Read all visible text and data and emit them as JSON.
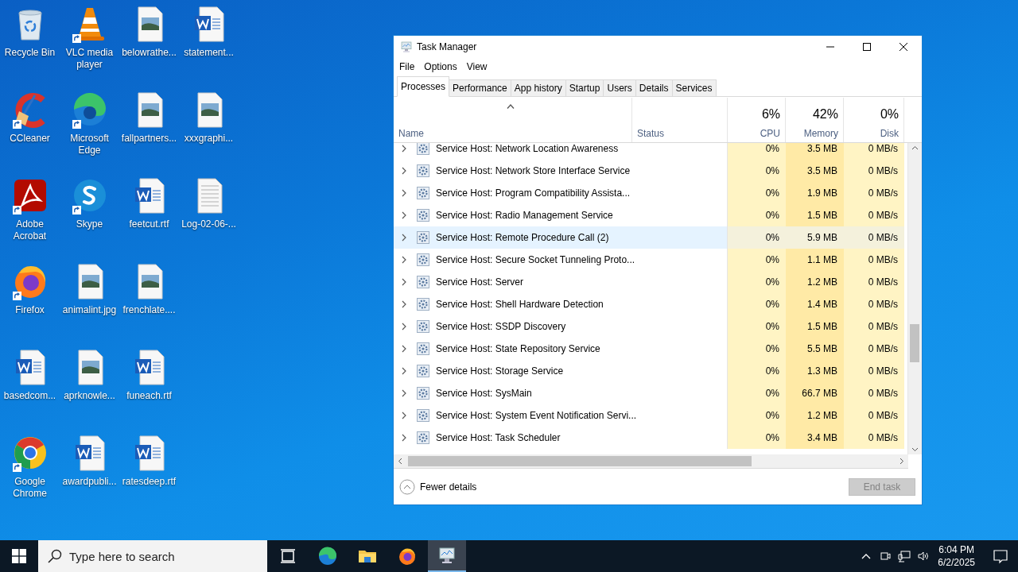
{
  "desktop": {
    "icons": [
      {
        "label": "Recycle Bin",
        "kind": "recycle",
        "shortcut": false
      },
      {
        "label": "CCleaner",
        "kind": "ccleaner",
        "shortcut": true
      },
      {
        "label": "Adobe Acrobat",
        "kind": "acrobat",
        "shortcut": true
      },
      {
        "label": "Firefox",
        "kind": "firefox",
        "shortcut": true
      },
      {
        "label": "basedcom...",
        "kind": "word",
        "shortcut": false
      },
      {
        "label": "Google Chrome",
        "kind": "chrome",
        "shortcut": true
      },
      {
        "label": "VLC media player",
        "kind": "vlc",
        "shortcut": true
      },
      {
        "label": "Microsoft Edge",
        "kind": "edge",
        "shortcut": true
      },
      {
        "label": "Skype",
        "kind": "skype",
        "shortcut": true
      },
      {
        "label": "animalint.jpg",
        "kind": "image",
        "shortcut": false
      },
      {
        "label": "aprknowle...",
        "kind": "image",
        "shortcut": false
      },
      {
        "label": "awardpubli...",
        "kind": "word",
        "shortcut": false
      },
      {
        "label": "belowrathe...",
        "kind": "image",
        "shortcut": false
      },
      {
        "label": "fallpartners...",
        "kind": "image",
        "shortcut": false
      },
      {
        "label": "feetcut.rtf",
        "kind": "word",
        "shortcut": false
      },
      {
        "label": "frenchlate....",
        "kind": "image",
        "shortcut": false
      },
      {
        "label": "funeach.rtf",
        "kind": "word",
        "shortcut": false
      },
      {
        "label": "ratesdeep.rtf",
        "kind": "word",
        "shortcut": false
      },
      {
        "label": "statement...",
        "kind": "word",
        "shortcut": false
      },
      {
        "label": "xxxgraphi...",
        "kind": "image",
        "shortcut": false
      },
      {
        "label": "Log-02-06-...",
        "kind": "text",
        "shortcut": false
      }
    ]
  },
  "window": {
    "title": "Task Manager"
  },
  "menu": [
    "File",
    "Options",
    "View"
  ],
  "tabs": [
    {
      "label": "Processes",
      "selected": true
    },
    {
      "label": "Performance",
      "selected": false
    },
    {
      "label": "App history",
      "selected": false
    },
    {
      "label": "Startup",
      "selected": false
    },
    {
      "label": "Users",
      "selected": false
    },
    {
      "label": "Details",
      "selected": false
    },
    {
      "label": "Services",
      "selected": false
    }
  ],
  "columns": [
    {
      "label": "Name"
    },
    {
      "label": "Status"
    },
    {
      "label": "CPU",
      "usage": "6%"
    },
    {
      "label": "Memory",
      "usage": "42%"
    },
    {
      "label": "Disk",
      "usage": "0%"
    }
  ],
  "rows": [
    {
      "name": "Service Host: Network Location Awareness",
      "cpu": "0%",
      "memory": "3.5 MB",
      "disk": "0 MB/s",
      "selected": false
    },
    {
      "name": "Service Host: Network Store Interface Service",
      "cpu": "0%",
      "memory": "3.5 MB",
      "disk": "0 MB/s",
      "selected": false
    },
    {
      "name": "Service Host: Program Compatibility Assista...",
      "cpu": "0%",
      "memory": "1.9 MB",
      "disk": "0 MB/s",
      "selected": false
    },
    {
      "name": "Service Host: Radio Management Service",
      "cpu": "0%",
      "memory": "1.5 MB",
      "disk": "0 MB/s",
      "selected": false
    },
    {
      "name": "Service Host: Remote Procedure Call (2)",
      "cpu": "0%",
      "memory": "5.9 MB",
      "disk": "0 MB/s",
      "selected": true
    },
    {
      "name": "Service Host: Secure Socket Tunneling Proto...",
      "cpu": "0%",
      "memory": "1.1 MB",
      "disk": "0 MB/s",
      "selected": false
    },
    {
      "name": "Service Host: Server",
      "cpu": "0%",
      "memory": "1.2 MB",
      "disk": "0 MB/s",
      "selected": false
    },
    {
      "name": "Service Host: Shell Hardware Detection",
      "cpu": "0%",
      "memory": "1.4 MB",
      "disk": "0 MB/s",
      "selected": false
    },
    {
      "name": "Service Host: SSDP Discovery",
      "cpu": "0%",
      "memory": "1.5 MB",
      "disk": "0 MB/s",
      "selected": false
    },
    {
      "name": "Service Host: State Repository Service",
      "cpu": "0%",
      "memory": "5.5 MB",
      "disk": "0 MB/s",
      "selected": false
    },
    {
      "name": "Service Host: Storage Service",
      "cpu": "0%",
      "memory": "1.3 MB",
      "disk": "0 MB/s",
      "selected": false
    },
    {
      "name": "Service Host: SysMain",
      "cpu": "0%",
      "memory": "66.7 MB",
      "disk": "0 MB/s",
      "selected": false
    },
    {
      "name": "Service Host: System Event Notification Servi...",
      "cpu": "0%",
      "memory": "1.2 MB",
      "disk": "0 MB/s",
      "selected": false
    },
    {
      "name": "Service Host: Task Scheduler",
      "cpu": "0%",
      "memory": "3.4 MB",
      "disk": "0 MB/s",
      "selected": false
    }
  ],
  "footer": {
    "details_label": "Fewer details",
    "end_task": {
      "label": "End task",
      "disabled": true
    }
  },
  "taskbar": {
    "search_placeholder": "Type here to search",
    "apps": [
      {
        "kind": "taskview",
        "active": false
      },
      {
        "kind": "edge",
        "active": false
      },
      {
        "kind": "folder",
        "active": false
      },
      {
        "kind": "firefox",
        "active": false
      },
      {
        "kind": "taskmanager",
        "active": true
      }
    ],
    "time": "6:04 PM",
    "date": "6/2/2025"
  }
}
